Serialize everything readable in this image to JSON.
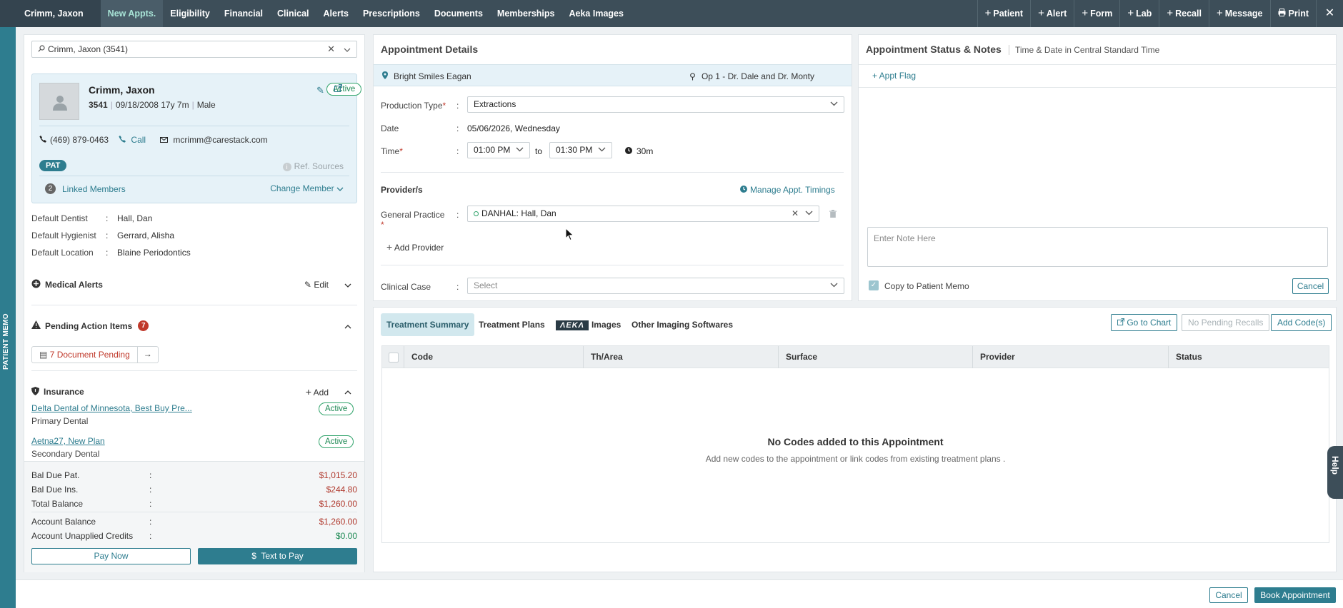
{
  "nav": {
    "patient_tab": "Crimm, Jaxon",
    "tabs": [
      "New Appts.",
      "Eligibility",
      "Financial",
      "Clinical",
      "Alerts",
      "Prescriptions",
      "Documents",
      "Memberships",
      "Aeka Images"
    ],
    "actions": [
      "Patient",
      "Alert",
      "Form",
      "Lab",
      "Recall",
      "Message",
      "Print"
    ],
    "close_icon": "close-icon"
  },
  "memo_strip": {
    "label": "PATIENT MEMO"
  },
  "patient": {
    "search_value": "Crimm, Jaxon (3541)",
    "name": "Crimm, Jaxon",
    "id": "3541",
    "dob": "09/18/2008",
    "age": "17y 7m",
    "gender": "Male",
    "status": "Active",
    "phone": "(469) 879-0463",
    "call_label": "Call",
    "email": "mcrimm@carestack.com",
    "tag": "PAT",
    "ref_sources": "Ref. Sources",
    "linked_count": "2",
    "linked_label": "Linked Members",
    "change_member": "Change Member"
  },
  "defaults": [
    {
      "label": "Default Dentist",
      "value": "Hall, Dan"
    },
    {
      "label": "Default Hygienist",
      "value": "Gerrard, Alisha"
    },
    {
      "label": "Default Location",
      "value": "Blaine Periodontics"
    }
  ],
  "medical_alerts": {
    "title": "Medical Alerts",
    "edit": "Edit"
  },
  "pending": {
    "title": "Pending Action Items",
    "count": "7",
    "doc_button": "7 Document Pending"
  },
  "insurance": {
    "title": "Insurance",
    "add": "Add",
    "plans": [
      {
        "name": "Delta Dental of Minnesota, Best Buy Pre...",
        "type": "Primary Dental",
        "status": "Active"
      },
      {
        "name": "Aetna27, New Plan",
        "type": "Secondary Dental",
        "status": "Active"
      }
    ]
  },
  "balances": [
    {
      "label": "Bal Due Pat.",
      "value": "$1,015.20"
    },
    {
      "label": "Bal Due Ins.",
      "value": "$244.80"
    },
    {
      "label": "Total Balance",
      "value": "$1,260.00"
    },
    {
      "label": "Account Balance",
      "value": "$1,260.00"
    },
    {
      "label": "Account Unapplied Credits",
      "value": "$0.00"
    }
  ],
  "pay_now": "Pay Now",
  "text_to_pay": "Text to Pay",
  "appointment": {
    "title": "Appointment Details",
    "location": "Bright Smiles Eagan",
    "operatory": "Op 1 - Dr. Dale and Dr. Monty",
    "production_label": "Production Type",
    "production_value": "Extractions",
    "date_label": "Date",
    "date_value": "05/06/2026, Wednesday",
    "time_label": "Time",
    "time_from": "01:00 PM",
    "to": "to",
    "time_to": "01:30 PM",
    "duration": "30m",
    "providers_label": "Provider/s",
    "manage_timings": "Manage Appt. Timings",
    "gp_label": "General Practice",
    "provider_value": "DANHAL: Hall, Dan",
    "add_provider": "Add Provider",
    "clinical_case_label": "Clinical Case",
    "clinical_case_placeholder": "Select"
  },
  "status_notes": {
    "title": "Appointment Status & Notes",
    "subtitle": "Time & Date in Central Standard Time",
    "appt_flag": "+ Appt Flag",
    "note_placeholder": "Enter Note Here",
    "copy_memo": "Copy to Patient Memo",
    "cancel": "Cancel"
  },
  "treatment": {
    "tabs": [
      "Treatment Summary",
      "Treatment Plans",
      "Images",
      "Other Imaging Softwares"
    ],
    "aeka_logo": "ΛEKΛ",
    "go_to_chart": "Go to Chart",
    "no_recalls": "No Pending Recalls",
    "add_codes": "Add Code(s)",
    "columns": [
      "Code",
      "Th/Area",
      "Surface",
      "Provider",
      "Status"
    ],
    "empty_title": "No Codes added to this Appointment",
    "empty_sub": "Add new codes to the appointment or link codes from existing treatment plans ."
  },
  "footer": {
    "cancel": "Cancel",
    "book": "Book Appointment"
  },
  "help_label": "Help"
}
